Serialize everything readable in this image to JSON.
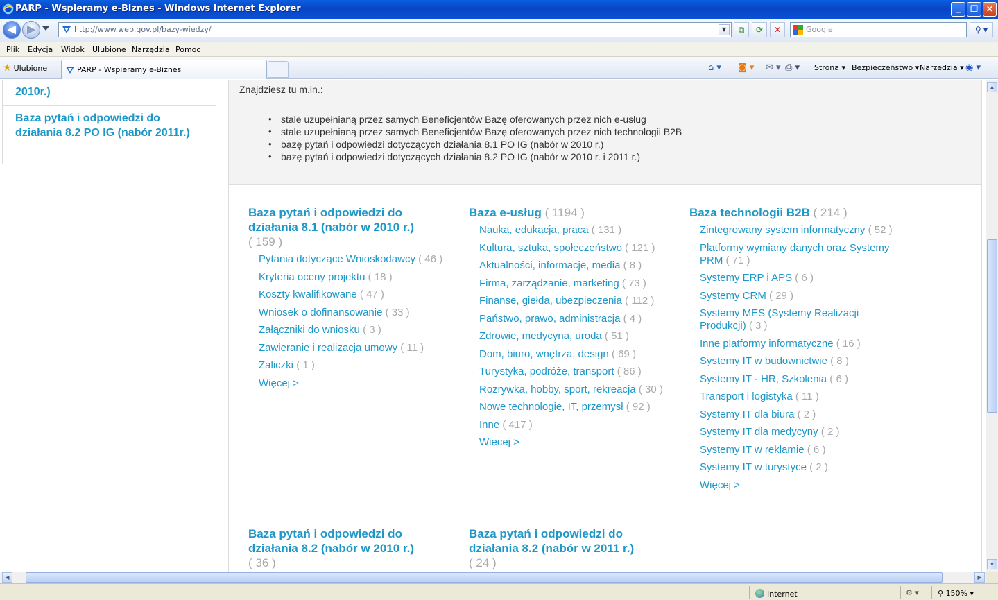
{
  "window": {
    "title": "PARP - Wspieramy e-Biznes - Windows Internet Explorer",
    "minimize_glyph": "_",
    "maximize_glyph": "❐",
    "close_glyph": "✕"
  },
  "address": {
    "url": "http://www.web.gov.pl/bazy-wiedzy/",
    "back_glyph": "◀",
    "forward_glyph": "▶"
  },
  "search": {
    "placeholder": "Google"
  },
  "menu": [
    "Plik",
    "Edycja",
    "Widok",
    "Ulubione",
    "Narzędzia",
    "Pomoc"
  ],
  "favorites": {
    "label": "Ulubione",
    "tab_title": "PARP - Wspieramy e-Biznes"
  },
  "command_bar": {
    "page": "Strona",
    "safety": "Bezpieczeństwo",
    "tools": "Narzędzia"
  },
  "sidebar": {
    "items": [
      {
        "label": "2010r.)"
      },
      {
        "label": "Baza pytań i odpowiedzi do działania 8.2 PO IG (nabór 2011r.)"
      }
    ]
  },
  "intro": {
    "lead": "Znajdziesz tu m.in.:",
    "bullets": [
      "stale uzupełnianą przez samych Beneficjentów Bazę oferowanych przez nich e-usług",
      "stale uzupełnianą przez samych Beneficjentów Bazę oferowanych przez nich technologii B2B",
      "bazę pytań i odpowiedzi dotyczących działania 8.1 PO IG (nabór w 2010 r.)",
      "bazę pytań i odpowiedzi dotyczących działania 8.2 PO IG (nabór w 2010 r. i 2011 r.)"
    ]
  },
  "categories": [
    {
      "title": "Baza pytań i odpowiedzi do działania 8.1 (nabór w 2010 r.)",
      "count": "( 159 )",
      "items": [
        {
          "label": "Pytania dotyczące Wnioskodawcy",
          "count": "( 46 )"
        },
        {
          "label": "Kryteria oceny projektu",
          "count": "( 18 )"
        },
        {
          "label": "Koszty kwalifikowane",
          "count": "( 47 )"
        },
        {
          "label": "Wniosek o dofinansowanie",
          "count": "( 33 )"
        },
        {
          "label": "Załączniki do wniosku",
          "count": "( 3 )"
        },
        {
          "label": "Zawieranie i realizacja umowy",
          "count": "( 11 )"
        },
        {
          "label": "Zaliczki",
          "count": "( 1 )"
        }
      ],
      "more": "Więcej >"
    },
    {
      "title": "Baza e-usług",
      "count": "( 1194 )",
      "items": [
        {
          "label": "Nauka, edukacja, praca",
          "count": "( 131 )"
        },
        {
          "label": "Kultura, sztuka, społeczeństwo",
          "count": "( 121 )"
        },
        {
          "label": "Aktualności, informacje, media",
          "count": "( 8 )"
        },
        {
          "label": "Firma, zarządzanie, marketing",
          "count": "( 73 )"
        },
        {
          "label": "Finanse, giełda, ubezpieczenia",
          "count": "( 112 )"
        },
        {
          "label": "Państwo, prawo, administracja",
          "count": "( 4 )"
        },
        {
          "label": "Zdrowie, medycyna, uroda",
          "count": "( 51 )"
        },
        {
          "label": "Dom, biuro, wnętrza, design",
          "count": "( 69 )"
        },
        {
          "label": "Turystyka, podróże, transport",
          "count": "( 86 )"
        },
        {
          "label": "Rozrywka, hobby, sport, rekreacja",
          "count": "( 30 )"
        },
        {
          "label": "Nowe technologie, IT, przemysł",
          "count": "( 92 )"
        },
        {
          "label": "Inne",
          "count": "( 417 )"
        }
      ],
      "more": "Więcej >"
    },
    {
      "title": "Baza technologii B2B",
      "count": "( 214 )",
      "items": [
        {
          "label": "Zintegrowany system informatyczny",
          "count": "( 52 )"
        },
        {
          "label": "Platformy wymiany danych oraz Systemy PRM",
          "count": "( 71 )"
        },
        {
          "label": "Systemy ERP i APS",
          "count": "( 6 )"
        },
        {
          "label": "Systemy CRM",
          "count": "( 29 )"
        },
        {
          "label": "Systemy MES (Systemy Realizacji Produkcji)",
          "count": "( 3 )"
        },
        {
          "label": "Inne platformy informatyczne",
          "count": "( 16 )"
        },
        {
          "label": "Systemy IT w budownictwie",
          "count": "( 8 )"
        },
        {
          "label": "Systemy IT - HR, Szkolenia",
          "count": "( 6 )"
        },
        {
          "label": "Transport i logistyka",
          "count": "( 11 )"
        },
        {
          "label": "Systemy IT dla biura",
          "count": "( 2 )"
        },
        {
          "label": "Systemy IT dla medycyny",
          "count": "( 2 )"
        },
        {
          "label": "Systemy IT w reklamie",
          "count": "( 6 )"
        },
        {
          "label": "Systemy IT w turystyce",
          "count": "( 2 )"
        }
      ],
      "more": "Więcej >"
    },
    {
      "title": "Baza pytań i odpowiedzi do działania 8.2 (nabór w 2010 r.)",
      "count": "( 36 )",
      "items": [],
      "more": ""
    },
    {
      "title": "Baza pytań i odpowiedzi do działania 8.2 (nabór w 2011 r.)",
      "count": "( 24 )",
      "items": [],
      "more": ""
    }
  ],
  "status": {
    "zone": "Internet",
    "zoom": "150%"
  },
  "colors": {
    "link": "#1d97c8",
    "count": "#a9a9a9",
    "titlebar": "#0a50d6"
  }
}
